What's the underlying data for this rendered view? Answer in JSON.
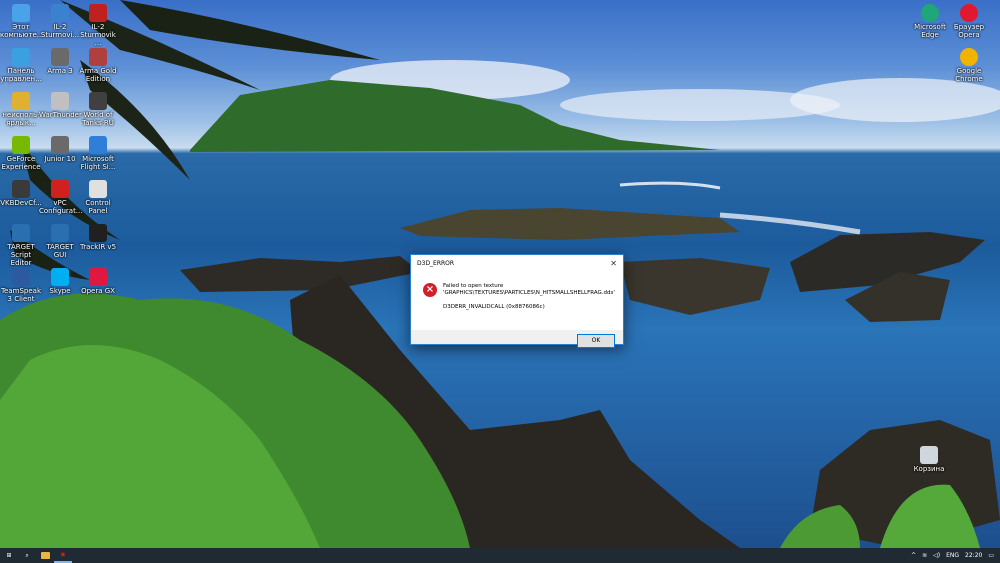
{
  "desktop": {
    "left_icons": [
      {
        "label": "Этот компьюте...",
        "color": "#4aa3e8"
      },
      {
        "label": "IL-2 Sturmovi...",
        "color": "#3a82d0"
      },
      {
        "label": "IL-2 Sturmovik ...",
        "color": "#c02020"
      },
      {
        "label": "Панель управлен...",
        "color": "#3ba0e0"
      },
      {
        "label": "Arma 3",
        "color": "#6a6a6a"
      },
      {
        "label": "Arma Gold Edition",
        "color": "#b04040"
      },
      {
        "label": "неисполь-ярлык...",
        "color": "#e0b030"
      },
      {
        "label": "WarThunder",
        "color": "#c0c0c0"
      },
      {
        "label": "World of Tanks RU",
        "color": "#404040"
      },
      {
        "label": "GeForce Experience",
        "color": "#76b900"
      },
      {
        "label": "Junior 10",
        "color": "#6a6a6a"
      },
      {
        "label": "Microsoft Flight Si...",
        "color": "#2f7fd8"
      },
      {
        "label": "VKBDevCf...",
        "color": "#3a3a3a"
      },
      {
        "label": "vPC Configurat...",
        "color": "#d02020"
      },
      {
        "label": "Control Panel",
        "color": "#e0e0e0"
      },
      {
        "label": "TARGET Script Editor",
        "color": "#2a6fb0"
      },
      {
        "label": "TARGET GUI",
        "color": "#2a6fb0"
      },
      {
        "label": "TrackIR v5",
        "color": "#202020"
      },
      {
        "label": "TeamSpeak 3 Client",
        "color": "#2c5aa0"
      },
      {
        "label": "Skype",
        "color": "#00aff0"
      },
      {
        "label": "Opera GX",
        "color": "#e01840"
      }
    ],
    "right_icons": [
      {
        "label": "Microsoft Edge",
        "color": "#1fa67a"
      },
      {
        "label": "Браузер Opera",
        "color": "#e01830"
      },
      {
        "label": "Google Chrome",
        "color": "#f0b400"
      }
    ],
    "recycle_bin": {
      "label": "Корзина"
    }
  },
  "dialog": {
    "title": "D3D_ERROR",
    "close": "✕",
    "message_line1": "Failed to open texture",
    "message_line2": "'GRAPHICS\\TEXTURES\\PARTICLES\\N_HITSMALLSHELLFRAG.dds'",
    "error_code": "D3DERR_INVALIDCALL (0x8876086c)",
    "ok_label": "OK"
  },
  "taskbar": {
    "start": "⊞",
    "search": "⌕",
    "language": "ENG",
    "time": "22:20",
    "tray_up": "^",
    "wifi": "≋",
    "volume": "◁)",
    "notifications": "▭"
  }
}
